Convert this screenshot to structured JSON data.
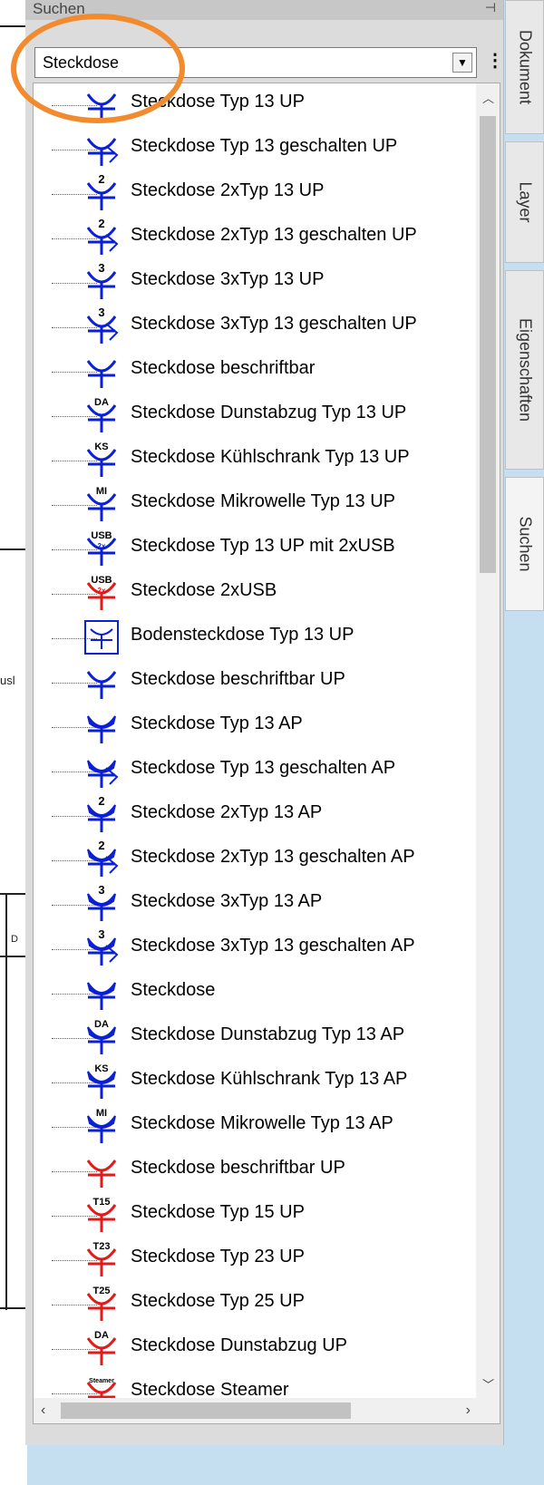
{
  "panel": {
    "title": "Suchen",
    "pin_icon": "pin-icon"
  },
  "search": {
    "value": "Steckdose",
    "dropdown_icon": "chevron-down-icon",
    "menu_icon": "kebab-icon"
  },
  "side_tabs": [
    {
      "label": "Dokument",
      "active": false
    },
    {
      "label": "Layer",
      "active": false
    },
    {
      "label": "Eigenschaften",
      "active": false
    },
    {
      "label": "Suchen",
      "active": true
    }
  ],
  "background_fragments": [
    "usl",
    "D"
  ],
  "colors": {
    "highlight": "#f28a2e",
    "symbol_blue": "#0a1fd6",
    "symbol_red": "#e21a1a",
    "tab_bg": "#e8e8e8",
    "panel_bg": "#dcdcdc"
  },
  "items": [
    {
      "label": "Steckdose Typ 13 UP",
      "icon": "socket-type13-up",
      "color": "#0a1fd6"
    },
    {
      "label": "Steckdose Typ 13 geschalten UP",
      "icon": "socket-type13-switched-up",
      "color": "#0a1fd6"
    },
    {
      "label": "Steckdose 2xTyp 13 UP",
      "icon": "socket-2x-type13-up",
      "color": "#0a1fd6",
      "mark": "2"
    },
    {
      "label": "Steckdose 2xTyp 13 geschalten UP",
      "icon": "socket-2x-type13-switched-up",
      "color": "#0a1fd6",
      "mark": "2"
    },
    {
      "label": "Steckdose 3xTyp 13 UP",
      "icon": "socket-3x-type13-up",
      "color": "#0a1fd6",
      "mark": "3"
    },
    {
      "label": "Steckdose 3xTyp 13 geschalten UP",
      "icon": "socket-3x-type13-switched-up",
      "color": "#0a1fd6",
      "mark": "3"
    },
    {
      "label": "Steckdose beschriftbar",
      "icon": "socket-labelable",
      "color": "#0a1fd6"
    },
    {
      "label": "Steckdose Dunstabzug Typ 13 UP",
      "icon": "socket-extractor-hood-up",
      "color": "#0a1fd6",
      "mark": "DA"
    },
    {
      "label": "Steckdose Kühlschrank Typ 13 UP",
      "icon": "socket-fridge-up",
      "color": "#0a1fd6",
      "mark": "KS"
    },
    {
      "label": "Steckdose Mikrowelle Typ 13 UP",
      "icon": "socket-microwave-up",
      "color": "#0a1fd6",
      "mark": "MI"
    },
    {
      "label": "Steckdose Typ 13 UP mit 2xUSB",
      "icon": "socket-type13-usb",
      "color": "#0a1fd6",
      "mark": "USB",
      "mark2": "2x"
    },
    {
      "label": "Steckdose  2xUSB",
      "icon": "socket-usb",
      "color": "#e21a1a",
      "mark": "USB",
      "mark2": "2x"
    },
    {
      "label": "Bodensteckdose Typ 13 UP",
      "icon": "floor-socket",
      "color": "#0a1fd6"
    },
    {
      "label": "Steckdose beschriftbar UP",
      "icon": "socket-labelable-up",
      "color": "#0a1fd6"
    },
    {
      "label": "Steckdose Typ 13 AP",
      "icon": "socket-type13-ap",
      "color": "#0a1fd6"
    },
    {
      "label": "Steckdose Typ 13 geschalten AP",
      "icon": "socket-type13-switched-ap",
      "color": "#0a1fd6"
    },
    {
      "label": "Steckdose 2xTyp 13 AP",
      "icon": "socket-2x-type13-ap",
      "color": "#0a1fd6",
      "mark": "2"
    },
    {
      "label": "Steckdose 2xTyp 13 geschalten AP",
      "icon": "socket-2x-type13-switched-ap",
      "color": "#0a1fd6",
      "mark": "2"
    },
    {
      "label": "Steckdose 3xTyp 13 AP",
      "icon": "socket-3x-type13-ap",
      "color": "#0a1fd6",
      "mark": "3"
    },
    {
      "label": "Steckdose 3xTyp 13 geschalten AP",
      "icon": "socket-3x-type13-switched-ap",
      "color": "#0a1fd6",
      "mark": "3"
    },
    {
      "label": "Steckdose",
      "icon": "socket-ap",
      "color": "#0a1fd6"
    },
    {
      "label": "Steckdose Dunstabzug Typ 13 AP",
      "icon": "socket-extractor-hood-ap",
      "color": "#0a1fd6",
      "mark": "DA"
    },
    {
      "label": "Steckdose Kühlschrank Typ 13 AP",
      "icon": "socket-fridge-ap",
      "color": "#0a1fd6",
      "mark": "KS"
    },
    {
      "label": "Steckdose Mikrowelle Typ 13 AP",
      "icon": "socket-microwave-ap",
      "color": "#0a1fd6",
      "mark": "MI"
    },
    {
      "label": "Steckdose beschriftbar UP",
      "icon": "socket-labelable-up-red",
      "color": "#e21a1a"
    },
    {
      "label": "Steckdose Typ 15 UP",
      "icon": "socket-type15-up",
      "color": "#e21a1a",
      "mark": "T15"
    },
    {
      "label": "Steckdose Typ 23 UP",
      "icon": "socket-type23-up",
      "color": "#e21a1a",
      "mark": "T23"
    },
    {
      "label": "Steckdose Typ 25 UP",
      "icon": "socket-type25-up",
      "color": "#e21a1a",
      "mark": "T25"
    },
    {
      "label": "Steckdose Dunstabzug UP",
      "icon": "socket-extractor-hood-red",
      "color": "#e21a1a",
      "mark": "DA"
    },
    {
      "label": "Steckdose Steamer",
      "icon": "socket-steamer",
      "color": "#e21a1a",
      "mark": "Steamer"
    }
  ]
}
